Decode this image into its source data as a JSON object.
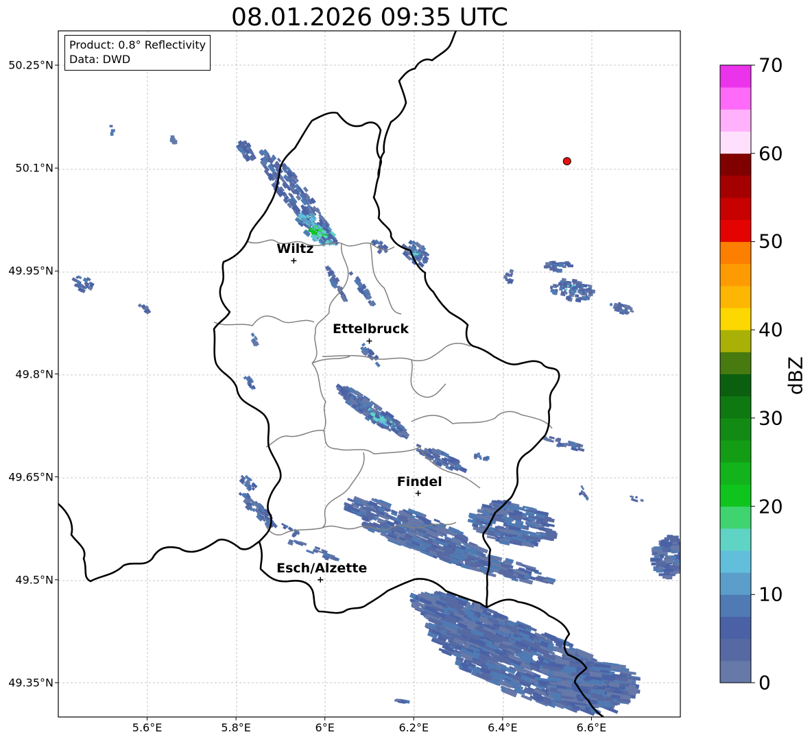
{
  "title": "08.01.2026 09:35 UTC",
  "info_box": {
    "product": "Product: 0.8° Reflectivity",
    "data": "Data: DWD"
  },
  "lat_ticks": [
    "50.25°N",
    "50.1°N",
    "49.95°N",
    "49.8°N",
    "49.65°N",
    "49.5°N",
    "49.35°N"
  ],
  "lon_ticks": [
    "5.6°E",
    "5.8°E",
    "6°E",
    "6.2°E",
    "6.4°E",
    "6.6°E"
  ],
  "cities": [
    {
      "name": "Wiltz",
      "lon": 5.93,
      "lat": 49.965
    },
    {
      "name": "Ettelbruck",
      "lon": 6.1,
      "lat": 49.848
    },
    {
      "name": "Findel",
      "lon": 6.21,
      "lat": 49.626
    },
    {
      "name": "Esch/Alzette",
      "lon": 5.99,
      "lat": 49.5
    }
  ],
  "marker": {
    "lon": 6.545,
    "lat": 50.11,
    "color": "#e81010"
  },
  "colorbar": {
    "label": "dBZ",
    "min": 0,
    "max": 70,
    "ticks": [
      "0",
      "10",
      "20",
      "30",
      "40",
      "50",
      "60",
      "70"
    ],
    "colors": [
      "#6679a8",
      "#5669a3",
      "#4a62a5",
      "#4f7ab3",
      "#5a9ec9",
      "#62bfdc",
      "#5fd4c4",
      "#3fd470",
      "#10c41e",
      "#12b31b",
      "#139d15",
      "#118b14",
      "#0e7811",
      "#0b600f",
      "#477a0f",
      "#a9b107",
      "#fcd700",
      "#fdb604",
      "#fe9b02",
      "#fd7f00",
      "#e30300",
      "#c70000",
      "#a40000",
      "#800000",
      "#ffe0fc",
      "#ffb1fb",
      "#ff6bf8",
      "#ec33ec"
    ]
  },
  "map_extent": {
    "lon_min": 5.4,
    "lon_max": 6.8,
    "lat_min": 49.3,
    "lat_max": 50.3
  }
}
